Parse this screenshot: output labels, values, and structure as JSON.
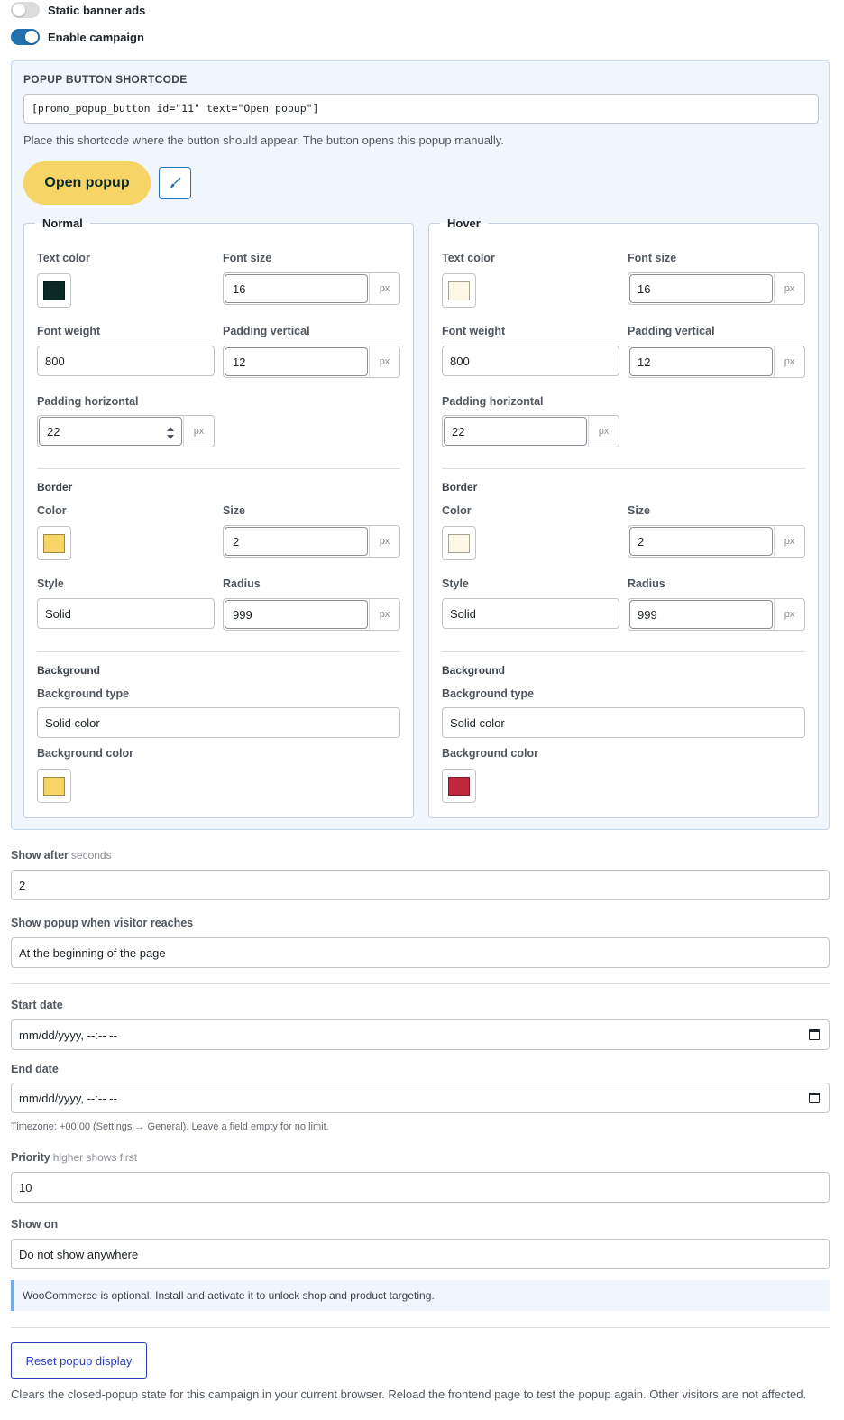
{
  "toggles": [
    {
      "label": "Static banner ads",
      "on": false
    },
    {
      "label": "Enable campaign",
      "on": true
    }
  ],
  "shortcode": {
    "title": "POPUP BUTTON SHORTCODE",
    "value": "[promo_popup_button id=\"11\" text=\"Open popup\"]",
    "help": "Place this shortcode where the button should appear. The button opens this popup manually.",
    "preview_label": "Open popup",
    "edit_icon": "paintbrush-icon"
  },
  "labels": {
    "text_color": "Text color",
    "font_size": "Font size",
    "font_weight": "Font weight",
    "padding_vertical": "Padding vertical",
    "padding_horizontal": "Padding horizontal",
    "border": "Border",
    "color": "Color",
    "size": "Size",
    "style": "Style",
    "radius": "Radius",
    "background": "Background",
    "background_type": "Background type",
    "background_color": "Background color",
    "unit": "px"
  },
  "normal": {
    "legend": "Normal",
    "text_color": "#0b2a26",
    "font_size": "16",
    "font_weight": "800",
    "padding_vertical": "12",
    "padding_horizontal": "22",
    "border_color": "#f6d465",
    "border_size": "2",
    "border_style": "Solid",
    "border_radius": "999",
    "background_type": "Solid color",
    "background_color": "#f6d465"
  },
  "hover": {
    "legend": "Hover",
    "text_color": "#fff8e6",
    "font_size": "16",
    "font_weight": "800",
    "padding_vertical": "12",
    "padding_horizontal": "22",
    "border_color": "#fff8e6",
    "border_size": "2",
    "border_style": "Solid",
    "border_radius": "999",
    "background_type": "Solid color",
    "background_color": "#c0283c"
  },
  "settings": {
    "show_after_label": "Show after",
    "show_after_hint": "seconds",
    "show_after_value": "2",
    "reach_label": "Show popup when visitor reaches",
    "reach_value": "At the beginning of the page",
    "start_label": "Start date",
    "start_value": "mm/dd/yyyy, --:-- --",
    "end_label": "End date",
    "end_value": "mm/dd/yyyy, --:-- --",
    "timezone_note": "Timezone: +00:00 (Settings → General). Leave a field empty for no limit.",
    "priority_label": "Priority",
    "priority_hint": "higher shows first",
    "priority_value": "10",
    "show_on_label": "Show on",
    "show_on_value": "Do not show anywhere",
    "woo_notice": "WooCommerce is optional. Install and activate it to unlock shop and product targeting.",
    "reset_label": "Reset popup display",
    "reset_help": "Clears the closed-popup state for this campaign in your current browser. Reload the frontend page to test the popup again. Other visitors are not affected."
  }
}
